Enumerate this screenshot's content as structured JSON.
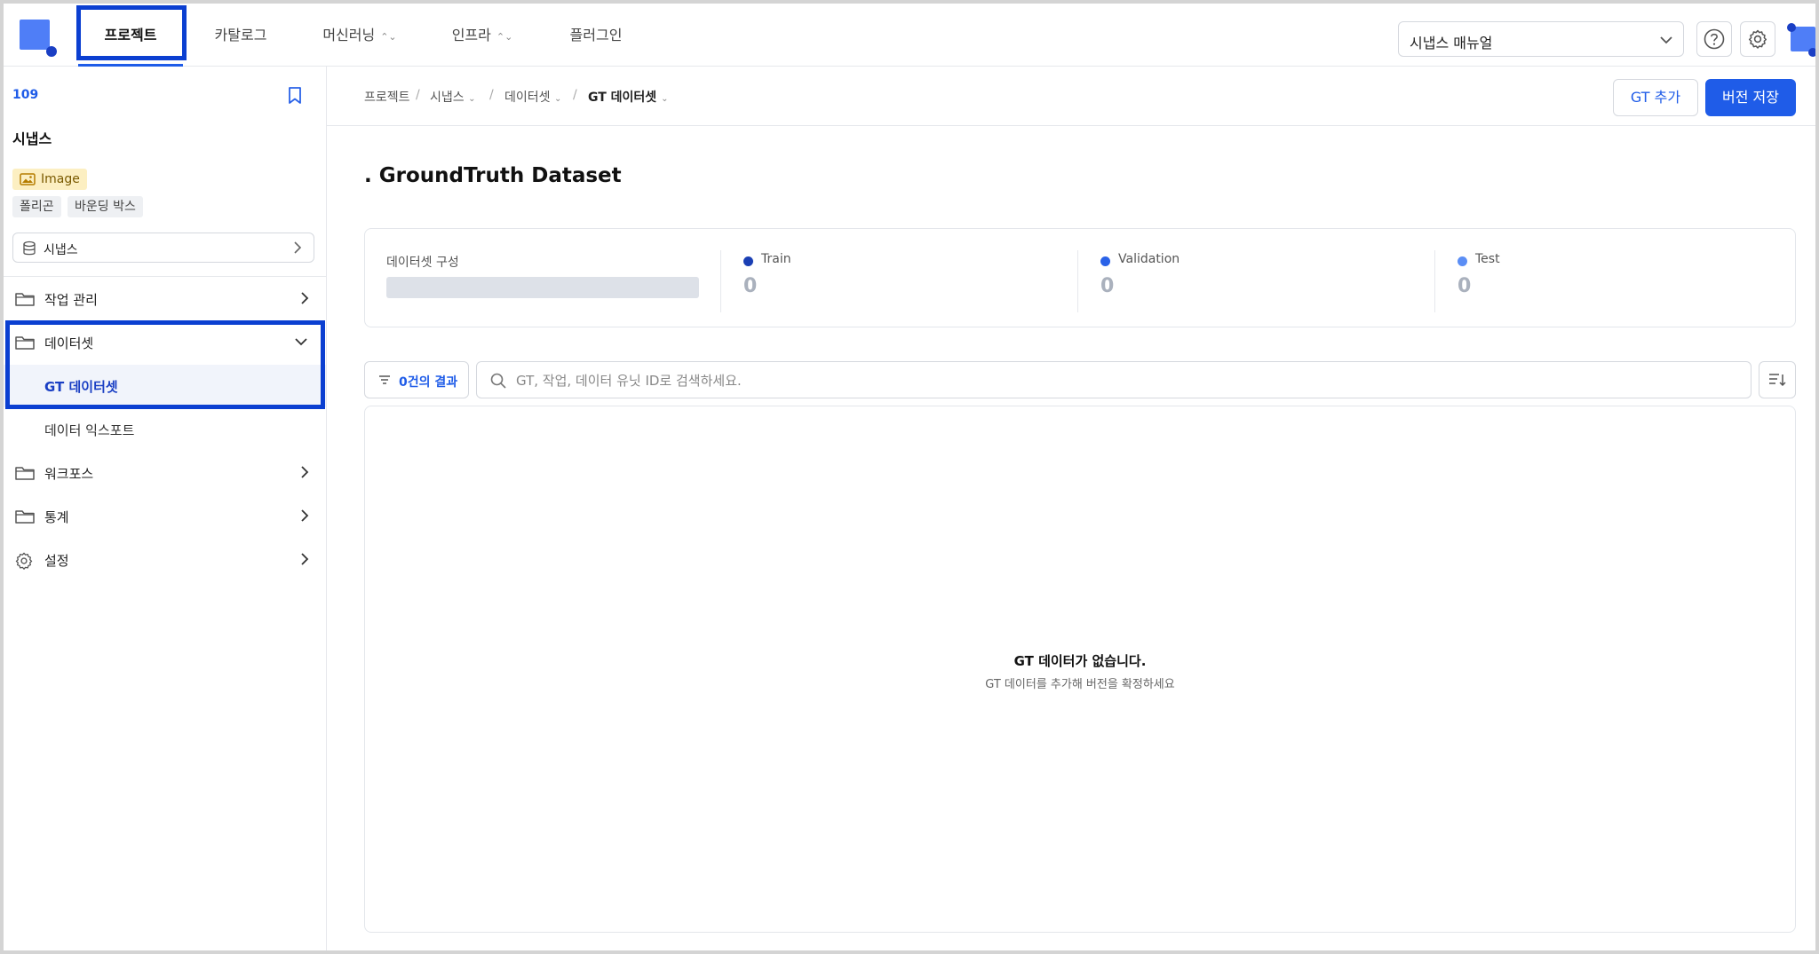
{
  "nav": {
    "tabs": [
      {
        "label": "프로젝트"
      },
      {
        "label": "카탈로그"
      },
      {
        "label": "머신러닝"
      },
      {
        "label": "인프라"
      },
      {
        "label": "플러그인"
      }
    ],
    "manual_select": "시냅스 매뉴얼"
  },
  "sidebar": {
    "project_id": "109",
    "project_name": "시냅스",
    "data_type": "Image",
    "tags": [
      "폴리곤",
      "바운딩 박스"
    ],
    "dataset_select": "시냅스",
    "menu": [
      {
        "label": "작업 관리"
      },
      {
        "label": "데이터셋"
      },
      {
        "label": "워크포스"
      },
      {
        "label": "통계"
      },
      {
        "label": "설정"
      }
    ],
    "submenu": [
      {
        "label": "GT 데이터셋"
      },
      {
        "label": "데이터 익스포트"
      }
    ]
  },
  "breadcrumb": [
    "프로젝트",
    "시냅스",
    "데이터셋",
    "GT 데이터셋"
  ],
  "buttons": {
    "add_gt": "GT 추가",
    "save_version": "버전 저장"
  },
  "page_title": ". GroundTruth Dataset",
  "stats": {
    "composition_label": "데이터셋 구성",
    "items": [
      {
        "name": "Train",
        "value": "0",
        "color": "#1a3fb4"
      },
      {
        "name": "Validation",
        "value": "0",
        "color": "#2a62e8"
      },
      {
        "name": "Test",
        "value": "0",
        "color": "#5b8ef5"
      }
    ]
  },
  "filter": {
    "count": "0건의 결과"
  },
  "search": {
    "placeholder": "GT, 작업, 데이터 유닛 ID로 검색하세요."
  },
  "empty": {
    "title": "GT 데이터가 없습니다.",
    "subtitle": "GT 데이터를 추가해 버전을 확정하세요"
  },
  "colors": {
    "accent": "#1f5ce8",
    "highlight": "#0b3fd1"
  }
}
